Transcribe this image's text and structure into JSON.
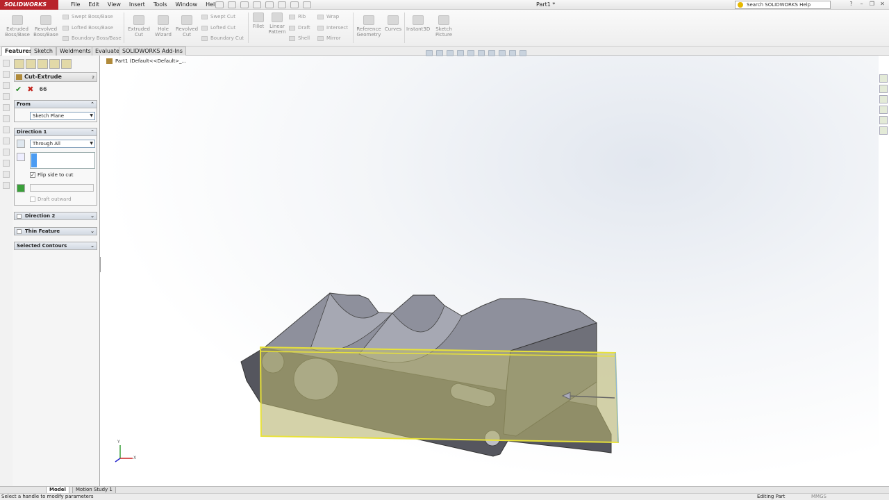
{
  "app": {
    "logo": "SOLIDWORKS",
    "doc_title": "Part1 *",
    "search_placeholder": "Search SOLIDWORKS Help"
  },
  "menu": [
    "File",
    "Edit",
    "View",
    "Insert",
    "Tools",
    "Window",
    "Help"
  ],
  "ribbon": {
    "extruded_boss": "Extruded Boss/Base",
    "revolved_boss": "Revolved Boss/Base",
    "swept_boss": "Swept Boss/Base",
    "lofted_boss": "Lofted Boss/Base",
    "boundary_boss": "Boundary Boss/Base",
    "extruded_cut": "Extruded Cut",
    "hole_wizard": "Hole Wizard",
    "revolved_cut": "Revolved Cut",
    "swept_cut": "Swept Cut",
    "lofted_cut": "Lofted Cut",
    "boundary_cut": "Boundary Cut",
    "fillet": "Fillet",
    "linear_pattern": "Linear Pattern",
    "rib": "Rib",
    "draft": "Draft",
    "shell": "Shell",
    "wrap": "Wrap",
    "intersect": "Intersect",
    "mirror": "Mirror",
    "reference_geometry": "Reference Geometry",
    "curves": "Curves",
    "instant3d": "Instant3D",
    "sketch_picture": "Sketch Picture"
  },
  "tabs": [
    "Features",
    "Sketch",
    "Weldments",
    "Evaluate",
    "SOLIDWORKS Add-Ins"
  ],
  "property_manager": {
    "title": "Cut-Extrude",
    "from_label": "From",
    "from_value": "Sketch Plane",
    "direction1_label": "Direction 1",
    "end_condition": "Through All",
    "flip_side_label": "Flip side to cut",
    "flip_side_checked": true,
    "draft_outward_label": "Draft outward",
    "direction2_label": "Direction 2",
    "thin_feature_label": "Thin Feature",
    "selected_contours_label": "Selected Contours"
  },
  "tree": {
    "root": "Part1  (Default<<Default>_..."
  },
  "triad": {
    "y": "Y",
    "x": "X"
  },
  "bottom_tabs": [
    "Model",
    "Motion Study 1"
  ],
  "status": {
    "left": "Select a handle to modify parameters",
    "mode": "Editing Part",
    "units": "MMGS"
  },
  "colors": {
    "model_fill": "#55565e",
    "model_top": "#9a9ca8",
    "preview": "#b8b470",
    "preview_edge": "#e8e23a",
    "brand": "#b8232b"
  }
}
